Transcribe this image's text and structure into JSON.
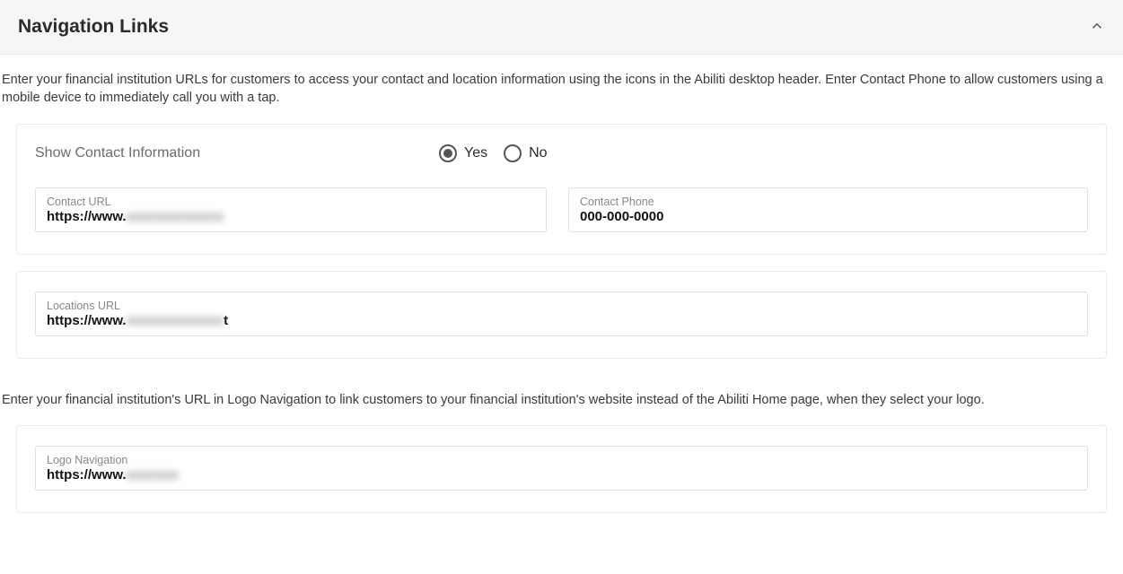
{
  "header": {
    "title": "Navigation Links"
  },
  "description1": "Enter your financial institution URLs for customers to access your contact and location information using the icons in the Abiliti desktop header. Enter Contact Phone to allow customers using a mobile device to immediately call you with a tap.",
  "contactCard": {
    "showContactLabel": "Show Contact Information",
    "radioYes": "Yes",
    "radioNo": "No",
    "selected": "Yes",
    "contactUrl": {
      "label": "Contact URL",
      "value": "https://www."
    },
    "contactPhone": {
      "label": "Contact Phone",
      "value": "000-000-0000"
    }
  },
  "locationsCard": {
    "locationsUrl": {
      "label": "Locations URL",
      "valuePrefix": "https://www.",
      "valueSuffix": "t"
    }
  },
  "description2": "Enter your financial institution's URL in Logo Navigation to link customers to your financial institution's website instead of the Abiliti Home page, when they select your logo.",
  "logoCard": {
    "logoNav": {
      "label": "Logo Navigation",
      "value": "https://www."
    }
  }
}
